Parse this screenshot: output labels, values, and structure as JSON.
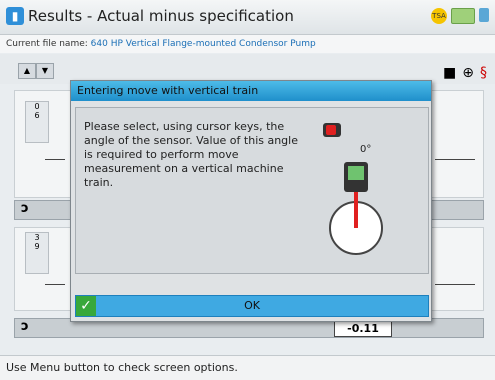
{
  "titlebar": {
    "title": "Results - Actual minus specification",
    "app_icon": "results-icon",
    "status_badge": "TSA"
  },
  "filebar": {
    "label": "Current file name:",
    "file_name": "640 HP Vertical Flange-mounted Condensor Pump"
  },
  "panels": {
    "upper_values": [
      "0",
      "6"
    ],
    "lower_values": [
      "3",
      "9"
    ],
    "value_readout": "-0.11"
  },
  "dialog": {
    "title": "Entering move with vertical train",
    "message": "Please select, using cursor keys, the angle of the sensor. Value of this angle is required to perform move measurement on a vertical machine train.",
    "angle": "0°",
    "ok_label": "OK"
  },
  "helpbar": {
    "text": "Use Menu button to check screen options."
  },
  "colors": {
    "accent_blue": "#3fa9e2",
    "ok_green": "#38a83b",
    "sensor_red": "#e02020"
  }
}
